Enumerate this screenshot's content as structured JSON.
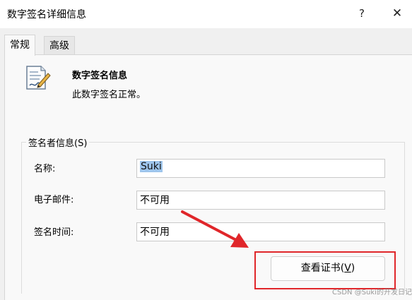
{
  "window": {
    "title": "数字签名详细信息",
    "help": "?",
    "close": "✕"
  },
  "tabs": [
    {
      "label": "常规",
      "active": true
    },
    {
      "label": "高级",
      "active": false
    }
  ],
  "header": {
    "heading": "数字签名信息",
    "status": "此数字签名正常。",
    "icon": "signed-document-icon"
  },
  "signer": {
    "legend": "签名者信息(S)",
    "fields": [
      {
        "label": "名称:",
        "value": "Suki",
        "selected": true
      },
      {
        "label": "电子邮件:",
        "value": "不可用",
        "selected": false
      },
      {
        "label": "签名时间:",
        "value": "不可用",
        "selected": false
      }
    ]
  },
  "button": {
    "label_main": "查看证书(",
    "mnemonic": "V",
    "label_end": ")"
  },
  "annotation": {
    "color": "#e0262a"
  },
  "watermark": "CSDN @Suki的开发日记"
}
